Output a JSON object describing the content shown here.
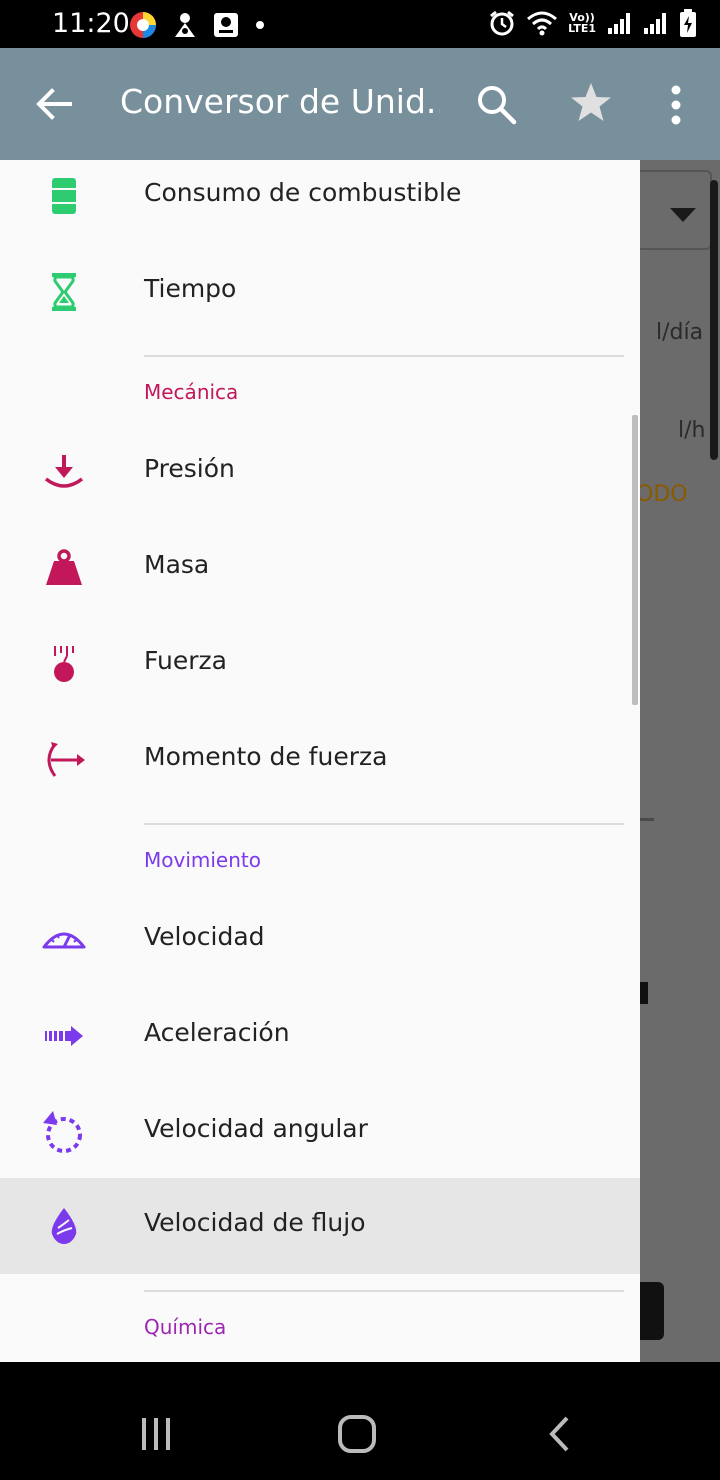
{
  "status_bar": {
    "time": "11:20",
    "network_label_top": "Vo))",
    "network_label_bottom": "LTE1"
  },
  "app_bar": {
    "title": "Conversor de Unid...",
    "back_icon": "arrow-back-icon",
    "search_icon": "search-icon",
    "favorite_icon": "star-icon",
    "more_icon": "more-vertical-icon",
    "background_color": "#78909c"
  },
  "background_content": {
    "unit_1": "l/día",
    "unit_2": "l/h",
    "mode_text": "ODO"
  },
  "drawer": {
    "items_top": [
      {
        "label": "Consumo de combustible",
        "icon": "fuel-barrel-icon",
        "color": "#2ecc71"
      },
      {
        "label": "Tiempo",
        "icon": "hourglass-icon",
        "color": "#2ecc71"
      }
    ],
    "sections": [
      {
        "title": "Mecánica",
        "color": "#c2185b",
        "items": [
          {
            "label": "Presión",
            "icon": "pressure-icon"
          },
          {
            "label": "Masa",
            "icon": "weight-icon"
          },
          {
            "label": "Fuerza",
            "icon": "force-apple-icon"
          },
          {
            "label": "Momento de fuerza",
            "icon": "torque-icon"
          }
        ]
      },
      {
        "title": "Movimiento",
        "color": "#7c3aed",
        "items": [
          {
            "label": "Velocidad",
            "icon": "speedometer-icon"
          },
          {
            "label": "Aceleración",
            "icon": "acceleration-arrow-icon"
          },
          {
            "label": "Velocidad angular",
            "icon": "angular-velocity-icon"
          },
          {
            "label": "Velocidad de flujo",
            "icon": "flow-drop-icon",
            "selected": true
          }
        ]
      },
      {
        "title": "Química",
        "color": "#9c27b0",
        "items": []
      }
    ]
  },
  "nav_bar": {
    "recents_icon": "recents-icon",
    "home_icon": "home-icon",
    "back_icon": "nav-back-icon"
  }
}
